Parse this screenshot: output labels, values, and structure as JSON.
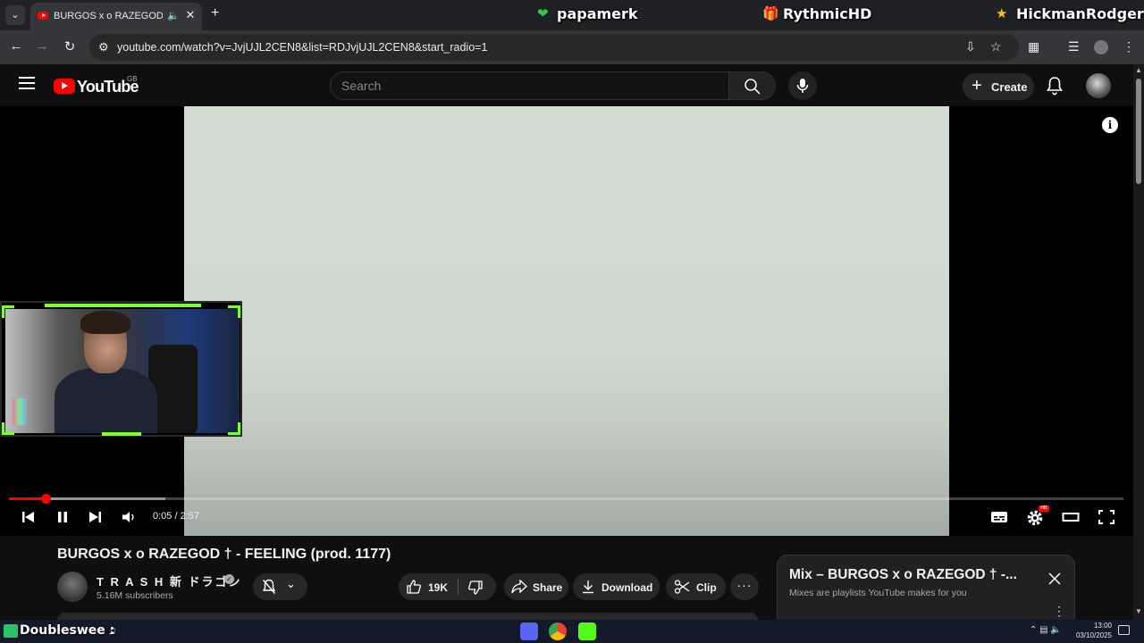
{
  "browser": {
    "tab": {
      "title": "BURGOS x o RAZEGOD † - F"
    },
    "address": {
      "url": "youtube.com/watch?v=JvjUJL2CEN8&list=RDJvjUJL2CEN8&start_radio=1"
    }
  },
  "stream_overlay": {
    "names": [
      {
        "name": "papamerk",
        "icon": "heart-icon",
        "color": "#2ecc40"
      },
      {
        "name": "RythmicHD",
        "icon": "gift-icon",
        "color": "#f39c12"
      },
      {
        "name": "HickmanRodgers",
        "icon": "star-icon",
        "color": "#f1c40f"
      }
    ],
    "taskbar_name": "Doubleswee :"
  },
  "youtube": {
    "logo_text": "YouTube",
    "country_code": "GB",
    "search_placeholder": "Search",
    "create_label": "Create",
    "player": {
      "time": "0:05 / 2:57",
      "progress_fraction": 0.033,
      "buffered_fraction": 0.14,
      "settings_badge": "HD"
    },
    "video": {
      "title": "BURGOS x o RAZEGOD † - FEELING (prod. 1177)",
      "channel_name": "T R A S H 新 ドラゴン",
      "subscribers": "5.16M subscribers",
      "likes": "19K",
      "share_label": "Share",
      "download_label": "Download",
      "clip_label": "Clip"
    },
    "mix": {
      "title": "Mix – BURGOS x o RAZEGOD † -...",
      "subtitle": "Mixes are playlists YouTube makes for you"
    }
  },
  "taskbar": {
    "time": "13:00",
    "date": "03/10/2025"
  },
  "colors": {
    "accent_red": "#ff0000",
    "webcam_frame": "#7cff2a",
    "background": "#0f0f0f"
  }
}
